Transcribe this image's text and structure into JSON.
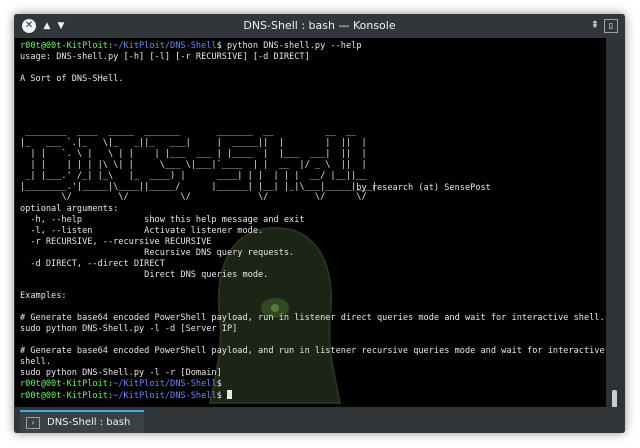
{
  "window": {
    "title": "DNS-Shell : bash — Konsole",
    "buttons": {
      "close": "✕",
      "up": "▲",
      "down": "▼",
      "pin": "⇞",
      "menu": "▯"
    }
  },
  "terminal": {
    "lines": [
      {
        "type": "prompt",
        "user": "r00t@00t-KitPloit",
        "path": "~/KitPloit/DNS-Shell",
        "cmd": "$ python DNS-shell.py --help"
      },
      {
        "type": "text",
        "text": "usage: DNS-shell.py [-h] [-l] [-r RECURSIVE] [-d DIRECT]"
      },
      {
        "type": "text",
        "text": ""
      },
      {
        "type": "text",
        "text": "A Sort of DNS-SHell."
      },
      {
        "type": "text",
        "text": ""
      },
      {
        "type": "text",
        "text": ""
      },
      {
        "type": "text",
        "text": ""
      },
      {
        "type": "text",
        "text": ""
      },
      {
        "type": "text",
        "text": ""
      },
      {
        "type": "text",
        "text": ""
      },
      {
        "type": "text",
        "text": ""
      },
      {
        "type": "text",
        "text": ""
      },
      {
        "type": "text",
        "text": ""
      },
      {
        "type": "text",
        "text": "                                                                 by research (at) SensePost"
      },
      {
        "type": "text",
        "text": ""
      },
      {
        "type": "text",
        "text": "optional arguments:"
      },
      {
        "type": "text",
        "text": "  -h, --help            show this help message and exit"
      },
      {
        "type": "text",
        "text": "  -l, --listen          Activate listener mode."
      },
      {
        "type": "text",
        "text": "  -r RECURSIVE, --recursive RECURSIVE"
      },
      {
        "type": "text",
        "text": "                        Recursive DNS query requests."
      },
      {
        "type": "text",
        "text": "  -d DIRECT, --direct DIRECT"
      },
      {
        "type": "text",
        "text": "                        Direct DNS queries mode."
      },
      {
        "type": "text",
        "text": ""
      },
      {
        "type": "text",
        "text": "Examples:"
      },
      {
        "type": "text",
        "text": ""
      },
      {
        "type": "text",
        "text": "# Generate base64 encoded PowerShell payload, run in listener direct queries mode and wait for interactive shell."
      },
      {
        "type": "text",
        "text": "sudo python DNS-Shell.py -l -d [Server IP]"
      },
      {
        "type": "text",
        "text": ""
      },
      {
        "type": "text",
        "text": "# Generate base64 encoded PowerShell payload, and run in listener recursive queries mode and wait for interactive"
      },
      {
        "type": "text",
        "text": "shell."
      },
      {
        "type": "text",
        "text": "sudo python DNS-Shell.py -l -r [Domain]"
      },
      {
        "type": "prompt",
        "user": "r00t@00t-KitPloit",
        "path": "~/KitPloit/DNS-Shell",
        "cmd": "$"
      },
      {
        "type": "prompt_cursor",
        "user": "r00t@00t-KitPloit",
        "path": "~/KitPloit/DNS-Shell",
        "cmd": "$ "
      }
    ],
    "ascii_art": " ________  ____  _____  _______       _______  __          __  __\n|_   ___ `.|_   \\|_   _||_   ___|     |  _____||  |        |  ||  |\n  | |   `. \\ |   \\ | |    | |___  ___ | |____  |  |___  ___|  ||  |\n  | |    | | | |\\ \\| |     \\___ \\|___|`____  | |  __  |/ _ \\  ||  |\n _| |___.' /_| |_\\   |_  ____) |      ____| | |  | | |  __/ |__||__\n|________.'|_____|\\____||_____/      |______| |__| |_|\\___|_____|___|\n        \\/         \\/          \\/             \\/         \\/      \\/"
  },
  "tabs": [
    {
      "label": "DNS-Shell : bash"
    }
  ]
}
